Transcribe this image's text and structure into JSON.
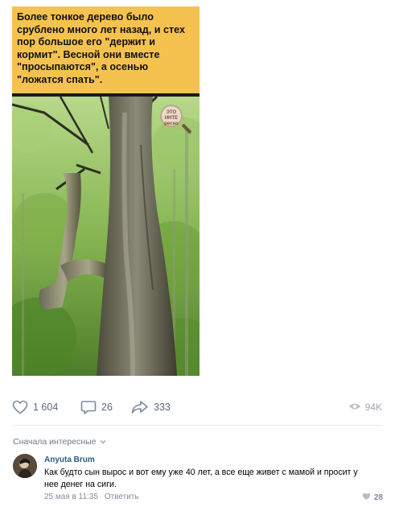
{
  "post": {
    "caption": "Более тонкое дерево было срублено много лет назад, и стех пор большое его \"держит и кормит\". Весной они вместе \"просыпаются\", а осенью \"ложатся спать\".",
    "watermark_text": "ЭТО ИНТЕ ресно"
  },
  "actions": {
    "likes": "1 604",
    "comments": "26",
    "shares": "333",
    "views": "94K"
  },
  "comments_section": {
    "sort_label": "Сначала интересные",
    "comment": {
      "author": "Anyuta Brum",
      "text": "Как будто сын вырос и вот ему уже 40 лет, а все еще живет с мамой и просит у нее денег на сиги.",
      "date": "25 мая в 11:35",
      "reply_label": "Ответить",
      "likes": "28"
    }
  },
  "icons": [
    "heart-icon",
    "comment-icon",
    "share-icon",
    "eye-icon",
    "chevron-down-icon"
  ],
  "colors": {
    "caption_bg": "#f6c24f",
    "link": "#2a5885",
    "meta": "#828a99"
  }
}
